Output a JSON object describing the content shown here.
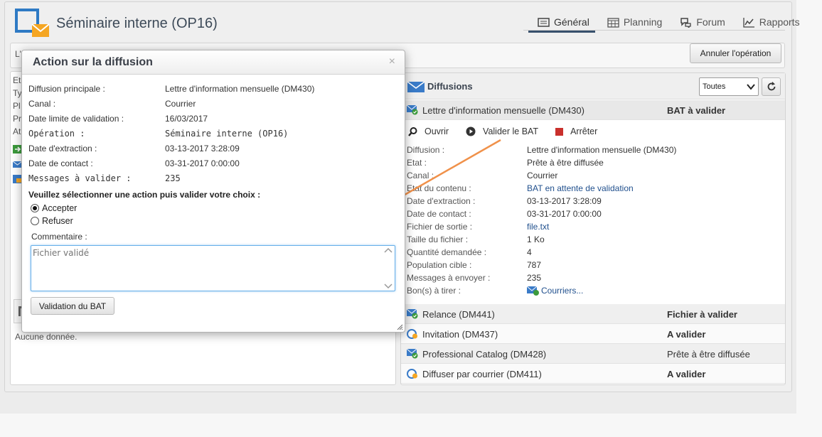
{
  "header": {
    "title": "Séminaire interne (OP16)",
    "tabs": [
      {
        "label": "Général",
        "icon": "general-icon",
        "active": true
      },
      {
        "label": "Planning",
        "icon": "calendar-icon",
        "active": false
      },
      {
        "label": "Forum",
        "icon": "forum-icon",
        "active": false
      },
      {
        "label": "Rapports",
        "icon": "chart-icon",
        "active": false
      }
    ]
  },
  "toolbar": {
    "left_text": "L'",
    "cancel_label": "Annuler l'opération"
  },
  "left_panel": {
    "peek_labels": [
      "Et",
      "Ty",
      "Pl",
      "Pr",
      "At"
    ],
    "no_data": "Aucune donnée."
  },
  "deliveries": {
    "title": "Diffusions",
    "filter_value": "Toutes",
    "selected": {
      "name": "Lettre d'information mensuelle (DM430)",
      "status": "BAT à valider",
      "actions": {
        "open": "Ouvrir",
        "validate": "Valider le BAT",
        "stop": "Arrêter"
      },
      "details": [
        {
          "label": "Diffusion :",
          "value": "Lettre d'information mensuelle (DM430)",
          "link": false
        },
        {
          "label": "Etat :",
          "value": "Prête à être diffusée",
          "link": false
        },
        {
          "label": "Canal :",
          "value": "Courrier",
          "link": false
        },
        {
          "label": "Etat du contenu :",
          "value": "BAT en attente de validation",
          "link": true
        },
        {
          "label": "Date d'extraction :",
          "value": "03-13-2017 3:28:09",
          "link": false
        },
        {
          "label": "Date de contact :",
          "value": "03-31-2017 0:00:00",
          "link": false
        },
        {
          "label": "Fichier de sortie :",
          "value": "file.txt",
          "link": true
        },
        {
          "label": "Taille du fichier :",
          "value": "1 Ko",
          "link": false
        },
        {
          "label": "Quantité demandée :",
          "value": "4",
          "link": false
        },
        {
          "label": "Population cible :",
          "value": "787",
          "link": false
        },
        {
          "label": "Messages à envoyer :",
          "value": "235",
          "link": false
        },
        {
          "label": "Bon(s) à tirer :",
          "value": "Courriers...",
          "link": true
        }
      ]
    },
    "rows": [
      {
        "name": "Relance (DM441)",
        "status": "Fichier à valider",
        "bold": true,
        "icon": "envelope-check-icon"
      },
      {
        "name": "Invitation (DM437)",
        "status": "A valider",
        "bold": true,
        "icon": "pending-icon"
      },
      {
        "name": "Professional Catalog (DM428)",
        "status": "Prête à être diffusée",
        "bold": false,
        "icon": "envelope-check-icon"
      },
      {
        "name": "Diffuser par courrier (DM411)",
        "status": "A valider",
        "bold": true,
        "icon": "pending-icon"
      }
    ]
  },
  "modal": {
    "title": "Action sur la diffusion",
    "close": "×",
    "fields": [
      {
        "label": "Diffusion principale :",
        "value": "Lettre d'information mensuelle (DM430)",
        "link": true,
        "mono": false
      },
      {
        "label": "Canal :",
        "value": "Courrier",
        "link": false,
        "mono": false
      },
      {
        "label": "Date limite de validation :",
        "value": "16/03/2017",
        "link": false,
        "mono": false
      },
      {
        "label": "Opération :",
        "value": "Séminaire interne (OP16)",
        "link": true,
        "mono": true
      },
      {
        "label": "Date d'extraction :",
        "value": "03-13-2017 3:28:09",
        "link": false,
        "mono": false
      },
      {
        "label": "Date de contact :",
        "value": "03-31-2017 0:00:00",
        "link": false,
        "mono": false
      },
      {
        "label": "Messages à valider :",
        "value": "235",
        "link": false,
        "mono": true
      }
    ],
    "instructions": "Veuillez sélectionner une action puis valider votre choix :",
    "options": [
      {
        "label": "Accepter",
        "checked": true
      },
      {
        "label": "Refuser",
        "checked": false
      }
    ],
    "comment_label": "Commentaire :",
    "comment_placeholder": "Fichier validé",
    "submit_label": "Validation du BAT"
  },
  "colors": {
    "accent": "#37506c",
    "link": "#22518e",
    "arrow": "#f0914a",
    "stop": "#c9302c"
  }
}
